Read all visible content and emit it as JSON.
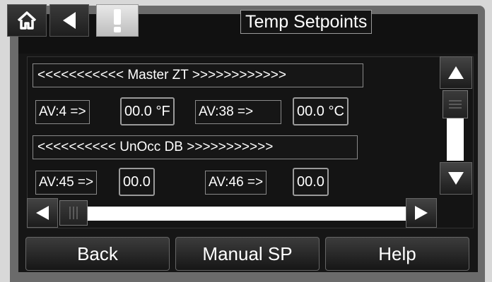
{
  "header": {
    "title": "Temp Setpoints",
    "icons": {
      "home": "home-icon",
      "back": "back-arrow-icon",
      "alarm": "exclamation-icon"
    }
  },
  "sections": [
    {
      "header": "<<<<<<<<<<< Master ZT >>>>>>>>>>>>",
      "points": [
        {
          "label": "AV:4 =>",
          "value": "00.0 °F"
        },
        {
          "label": "AV:38  =>",
          "value": "00.0 °C"
        }
      ]
    },
    {
      "header": "<<<<<<<<<< UnOcc DB >>>>>>>>>>>",
      "points": [
        {
          "label": "AV:45 =>",
          "value": "00.0"
        },
        {
          "label": "AV:46 =>",
          "value": "00.0"
        }
      ]
    }
  ],
  "footer": {
    "back_label": "Back",
    "manual_label": "Manual SP",
    "help_label": "Help"
  }
}
